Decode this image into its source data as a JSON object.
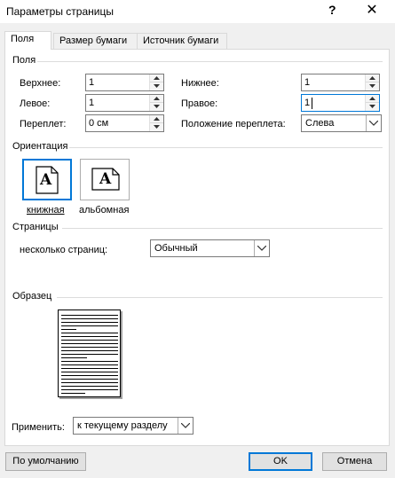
{
  "window": {
    "title": "Параметры страницы",
    "help_label": "?",
    "close_label": "✕"
  },
  "tabs": [
    {
      "label": "Поля",
      "active": true
    },
    {
      "label": "Размер бумаги",
      "active": false
    },
    {
      "label": "Источник бумаги",
      "active": false
    }
  ],
  "margins": {
    "group_label": "Поля",
    "top_label": "Верхнее:",
    "top_value": "1",
    "bottom_label": "Нижнее:",
    "bottom_value": "1",
    "left_label": "Левое:",
    "left_value": "1",
    "right_label": "Правое:",
    "right_value": "1",
    "gutter_label": "Переплет:",
    "gutter_value": "0 см",
    "gutter_pos_label": "Положение переплета:",
    "gutter_pos_value": "Слева"
  },
  "orientation": {
    "group_label": "Ориентация",
    "portrait_label": "книжная",
    "landscape_label": "альбомная",
    "icon_letter": "A",
    "selected": "portrait"
  },
  "pages": {
    "group_label": "Страницы",
    "multiple_label": "несколько страниц:",
    "multiple_value": "Обычный"
  },
  "preview": {
    "group_label": "Образец"
  },
  "apply": {
    "label": "Применить:",
    "value": "к текущему разделу"
  },
  "buttons": {
    "default_label": "По умолчанию",
    "ok_label": "OK",
    "cancel_label": "Отмена"
  },
  "colors": {
    "accent": "#0078d7",
    "panel_bg": "#ffffff",
    "dialog_bg": "#f0f0f0"
  }
}
